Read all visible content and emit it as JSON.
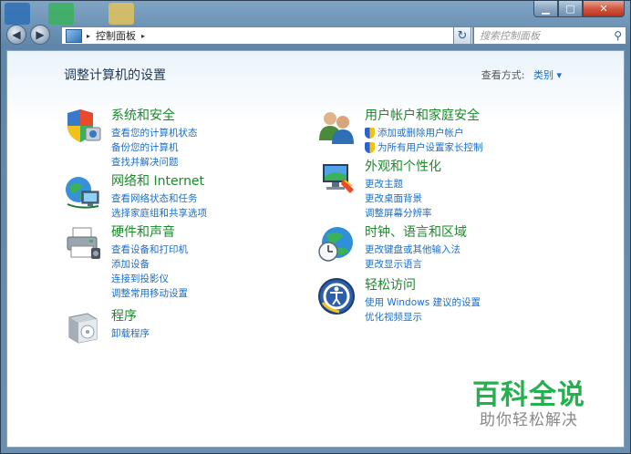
{
  "titlebar": {
    "min": "▁",
    "max": "□",
    "close": "✕"
  },
  "nav": {
    "back": "◀",
    "forward": "▶",
    "breadcrumb": "控制面板",
    "breadcrumb_sep": "▸",
    "search_placeholder": "搜索控制面板",
    "refresh": "↻",
    "search_icon": "⚲"
  },
  "page": {
    "title": "调整计算机的设置",
    "view_by_label": "查看方式:",
    "view_by_value": "类别 ▾"
  },
  "categories_left": [
    {
      "icon": "security-shield-icon",
      "title": "系统和安全",
      "links": [
        "查看您的计算机状态",
        "备份您的计算机",
        "查找并解决问题"
      ]
    },
    {
      "icon": "network-globe-icon",
      "title": "网络和 Internet",
      "links": [
        "查看网络状态和任务",
        "选择家庭组和共享选项"
      ]
    },
    {
      "icon": "printer-icon",
      "title": "硬件和声音",
      "links": [
        "查看设备和打印机",
        "添加设备",
        "连接到投影仪",
        "调整常用移动设置"
      ]
    },
    {
      "icon": "programs-box-icon",
      "title": "程序",
      "links": [
        "卸载程序"
      ]
    }
  ],
  "categories_right": [
    {
      "icon": "users-icon",
      "title": "用户帐户和家庭安全",
      "links": [
        "添加或删除用户帐户",
        "为所有用户设置家长控制"
      ],
      "shielded": true
    },
    {
      "icon": "appearance-monitor-icon",
      "title": "外观和个性化",
      "links": [
        "更改主题",
        "更改桌面背景",
        "调整屏幕分辨率"
      ]
    },
    {
      "icon": "clock-globe-icon",
      "title": "时钟、语言和区域",
      "links": [
        "更改键盘或其他输入法",
        "更改显示语言"
      ]
    },
    {
      "icon": "ease-of-access-icon",
      "title": "轻松访问",
      "links": [
        "使用 Windows 建议的设置",
        "优化视频显示"
      ]
    }
  ],
  "watermark": {
    "brand": "百科全说",
    "slogan": "助你轻松解决"
  },
  "colors": {
    "category_title": "#1a8a2a",
    "link": "#1a6ec9",
    "brand": "#23b14d"
  }
}
